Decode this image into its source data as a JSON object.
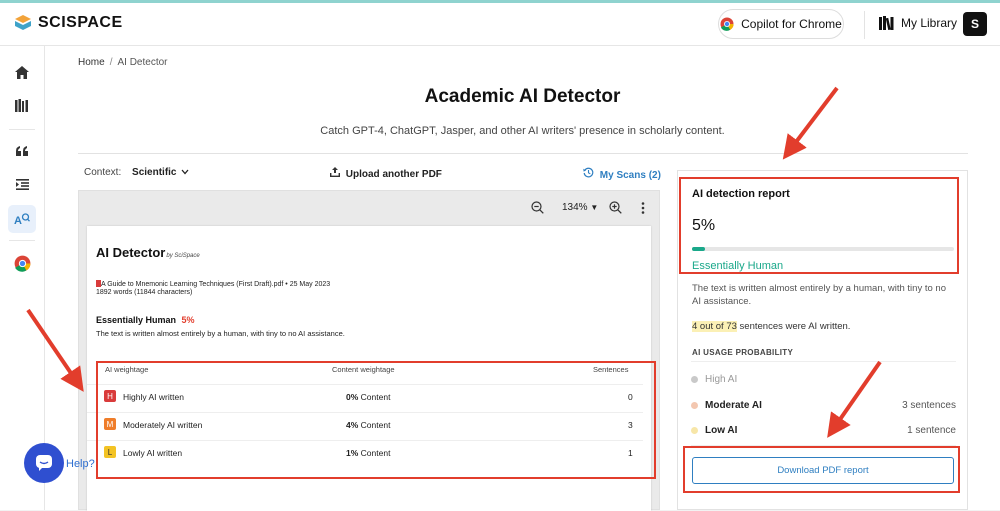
{
  "brand": {
    "name": "SCISPACE"
  },
  "topbar": {
    "copilot_label": "Copilot for Chrome",
    "library_label": "My Library",
    "avatar_initial": "S"
  },
  "sidebar": {
    "items": [
      "home-icon",
      "library-icon",
      "quote-icon",
      "indent-icon",
      "ai-detector-icon",
      "chrome-icon"
    ]
  },
  "breadcrumb": {
    "home": "Home",
    "current": "AI Detector"
  },
  "page": {
    "title": "Academic AI Detector",
    "subtitle": "Catch GPT-4, ChatGPT, Jasper, and other AI writers' presence in scholarly content."
  },
  "controls": {
    "context_label": "Context:",
    "context_value": "Scientific",
    "upload_label": "Upload another PDF",
    "scans_label": "My Scans (2)"
  },
  "viewer": {
    "zoom": "134%"
  },
  "document": {
    "heading": "AI Detector",
    "byline": "by SciSpace",
    "file_line": "A Guide to Mnemonic Learning Techniques (First Draft).pdf • 25 May 2023",
    "words_line": "1892 words (11844 characters)",
    "verdict": "Essentially Human",
    "verdict_percent": "5%",
    "verdict_desc": "The text is written almost entirely by a human, with tiny to no AI assistance.",
    "table_headers": {
      "weightage": "AI weightage",
      "content": "Content weightage",
      "sentences": "Sentences"
    },
    "rows": [
      {
        "badge": "H",
        "badge_color": "#d93b3b",
        "label": "Highly AI written",
        "pct": "0%",
        "content_word": "Content",
        "sentences": "0"
      },
      {
        "badge": "M",
        "badge_color": "#ef7d2a",
        "label": "Moderately AI written",
        "pct": "4%",
        "content_word": "Content",
        "sentences": "3"
      },
      {
        "badge": "L",
        "badge_color": "#f3c324",
        "label": "Lowly AI written",
        "pct": "1%",
        "content_word": "Content",
        "sentences": "1"
      }
    ]
  },
  "report": {
    "title": "AI detection report",
    "percent": "5%",
    "progress_fraction": 0.05,
    "verdict": "Essentially Human",
    "description": "The text is written almost entirely by a human, with tiny to no AI assistance.",
    "ai_sentences_highlight": "4 out of 73",
    "ai_sentences_rest": " sentences were AI written.",
    "usage_heading": "AI USAGE PROBABILITY",
    "usage": [
      {
        "label": "High AI",
        "count": "",
        "color": "#c9c9c9"
      },
      {
        "label": "Moderate AI",
        "count": "3 sentences",
        "color": "#f3c7b0"
      },
      {
        "label": "Low AI",
        "count": "1 sentence",
        "color": "#f7e6a8"
      }
    ],
    "download_label": "Download PDF report"
  },
  "help": {
    "label": "Help?"
  },
  "colors": {
    "accent": "#2f7fc1",
    "human_green": "#1aa88a",
    "annotation_red": "#e23d2c"
  }
}
